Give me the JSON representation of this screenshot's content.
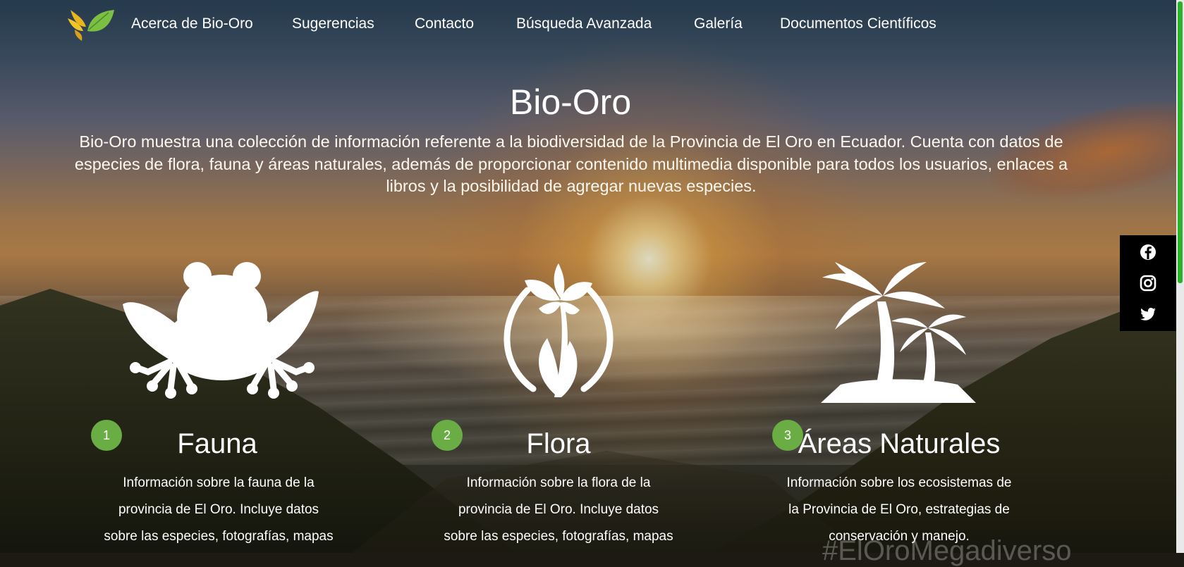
{
  "nav": {
    "items": [
      {
        "label": "Acerca de Bio-Oro"
      },
      {
        "label": "Sugerencias"
      },
      {
        "label": "Contacto"
      },
      {
        "label": "Búsqueda Avanzada"
      },
      {
        "label": "Galería"
      },
      {
        "label": "Documentos Científicos"
      }
    ]
  },
  "hero": {
    "title": "Bio-Oro",
    "description": "Bio-Oro muestra una colección de información referente a la biodiversidad de la Provincia de El Oro en Ecuador. Cuenta con datos de especies de flora, fauna y áreas naturales, además de proporcionar contenido multimedia disponible para todos los usuarios, enlaces a libros y la posibilidad de agregar nuevas especies."
  },
  "features": [
    {
      "number": "1",
      "title": "Fauna",
      "icon": "frog-icon",
      "lines": [
        "Información sobre la fauna de la",
        "provincia de El Oro. Incluye datos",
        "sobre las especies, fotografías, mapas"
      ]
    },
    {
      "number": "2",
      "title": "Flora",
      "icon": "flower-icon",
      "lines": [
        "Información sobre la flora de la",
        "provincia de El Oro. Incluye datos",
        "sobre las especies, fotografías, mapas"
      ]
    },
    {
      "number": "3",
      "title": "Áreas Naturales",
      "icon": "palm-trees-icon",
      "lines": [
        "Información sobre los ecosistemas de",
        "la Provincia de El Oro, estrategias de",
        "conservación y manejo."
      ]
    }
  ],
  "social": {
    "icons": [
      "facebook-icon",
      "instagram-icon",
      "twitter-icon"
    ]
  },
  "hashtag": "#ElOroMegadiverso",
  "colors": {
    "badge": "#6aad45",
    "social_bg": "#000000",
    "scroll_thumb": "#2bb22b"
  }
}
